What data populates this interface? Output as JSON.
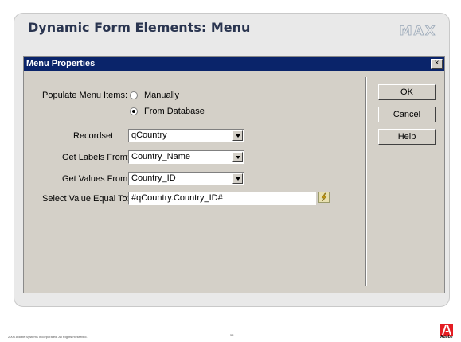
{
  "slide": {
    "title": "Dynamic Form Elements: Menu",
    "logo": "MAX",
    "footer_copyright": "2006 Adobe Systems Incorporated.  All Rights Reserved.",
    "page_number": "58",
    "adobe_label": "Adobe"
  },
  "dialog": {
    "title": "Menu Properties",
    "close_label": "×",
    "populate_label": "Populate Menu Items:",
    "options": [
      {
        "label": "Manually",
        "selected": false
      },
      {
        "label": "From Database",
        "selected": true
      }
    ],
    "recordset_label": "Recordset",
    "recordset_value": "qCountry",
    "labels_from_label": "Get Labels From:",
    "labels_from_value": "Country_Name",
    "values_from_label": "Get Values From:",
    "values_from_value": "Country_ID",
    "select_equal_label": "Select Value Equal To:",
    "select_equal_value": "#qCountry.Country_ID#",
    "buttons": {
      "ok": "OK",
      "cancel": "Cancel",
      "help": "Help"
    }
  },
  "colors": {
    "titlebar": "#0a246a",
    "dialog_face": "#d4d0c8",
    "slide_title": "#2a3550",
    "adobe_red": "#e41d23"
  }
}
